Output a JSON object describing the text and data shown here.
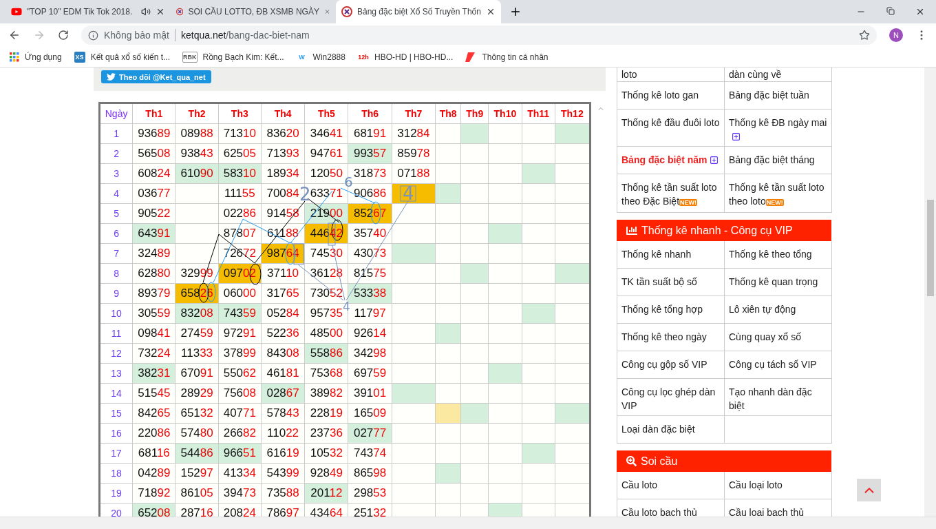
{
  "browser": {
    "tabs": [
      {
        "title": "\"TOP 10\" EDM Tik Tok 2018.",
        "kind": "video",
        "audio": true,
        "selected": false
      },
      {
        "title": "SOI CẦU LOTTO, ĐB XSMB NGÀY",
        "kind": "site",
        "audio": false,
        "selected": false
      },
      {
        "title": "Bảng đặc biệt Xổ Số Truyền Thốn",
        "kind": "site",
        "audio": false,
        "selected": true
      }
    ],
    "address": {
      "security": "Không bảo mật",
      "domain": "ketqua.net",
      "path": "/bang-dac-biet-nam"
    },
    "profile": "N",
    "bookmarks": [
      {
        "label": "Ứng dụng",
        "kind": "apps"
      },
      {
        "label": "Kết quả xổ số kiến t...",
        "kind": "tile",
        "icon_text": "XS"
      },
      {
        "label": "Rồng Bạch Kim: Kết...",
        "kind": "framed",
        "icon_text": "RBK"
      },
      {
        "label": "Win2888",
        "kind": "letter",
        "icon_text": "W"
      },
      {
        "label": "HBO-HD | HBO-HD...",
        "kind": "redtext",
        "icon_text": "12h"
      },
      {
        "label": "Thông tin cá nhân",
        "kind": "mark"
      }
    ]
  },
  "follow_button": "Theo dõi @Ket_qua_net",
  "table": {
    "day_header": "Ngày",
    "columns": [
      "Th1",
      "Th2",
      "Th3",
      "Th4",
      "Th5",
      "Th6",
      "Th7",
      "Th8",
      "Th9",
      "Th10",
      "Th11",
      "Th12"
    ],
    "rows": [
      {
        "day": "1",
        "cells": [
          {
            "value": "93689"
          },
          {
            "value": "08988"
          },
          {
            "value": "71310"
          },
          {
            "value": "83620"
          },
          {
            "value": "34641"
          },
          {
            "value": "68191"
          },
          {
            "value": "31284"
          },
          {},
          {
            "color": "#d4efdb"
          },
          {},
          {},
          {
            "color": "#d4efdb"
          }
        ]
      },
      {
        "day": "2",
        "cells": [
          {
            "value": "56508"
          },
          {
            "value": "93843"
          },
          {
            "value": "62505"
          },
          {
            "value": "71393"
          },
          {
            "value": "94761"
          },
          {
            "value": "99357",
            "color": "#d4efdb"
          },
          {
            "value": "85978"
          },
          {},
          {},
          {},
          {},
          {}
        ]
      },
      {
        "day": "3",
        "cells": [
          {
            "value": "60824"
          },
          {
            "value": "61090",
            "color": "#d4efdb"
          },
          {
            "value": "58310",
            "color": "#d4efdb"
          },
          {
            "value": "18934"
          },
          {
            "value": "12050"
          },
          {
            "value": "31873"
          },
          {
            "value": "07188"
          },
          {},
          {},
          {},
          {
            "color": "#d4efdb"
          },
          {}
        ]
      },
      {
        "day": "4",
        "cells": [
          {
            "value": "03677"
          },
          {},
          {
            "value": "11155"
          },
          {
            "value": "70084"
          },
          {
            "value": "63371"
          },
          {
            "value": "90686"
          },
          {
            "color": "#f5bc00"
          },
          {
            "color": "#d4efdb"
          },
          {},
          {},
          {},
          {}
        ]
      },
      {
        "day": "5",
        "cells": [
          {
            "value": "90522"
          },
          {},
          {
            "value": "02286"
          },
          {
            "value": "91458"
          },
          {
            "value": "21900",
            "color": "#d4efdb"
          },
          {
            "value": "85267",
            "color": "#f5bc00"
          },
          {},
          {},
          {},
          {},
          {},
          {}
        ]
      },
      {
        "day": "6",
        "cells": [
          {
            "value": "64391",
            "color": "#d4efdb"
          },
          {},
          {
            "value": "87807"
          },
          {
            "value": "61188"
          },
          {
            "value": "44642",
            "color": "#f5bc00"
          },
          {
            "value": "35740"
          },
          {},
          {},
          {},
          {
            "color": "#d4efdb"
          },
          {},
          {}
        ]
      },
      {
        "day": "7",
        "cells": [
          {
            "value": "32489"
          },
          {},
          {
            "value": "72672"
          },
          {
            "value": "98764",
            "color": "#f5bc00"
          },
          {
            "value": "74530"
          },
          {
            "value": "43073"
          },
          {
            "color": "#d4efdb"
          },
          {},
          {},
          {},
          {},
          {}
        ]
      },
      {
        "day": "8",
        "cells": [
          {
            "value": "62880"
          },
          {
            "value": "32999"
          },
          {
            "value": "09702",
            "color": "#f5bc00"
          },
          {
            "value": "37110"
          },
          {
            "value": "36128"
          },
          {
            "value": "81575"
          },
          {},
          {},
          {
            "color": "#d4efdb"
          },
          {},
          {},
          {
            "color": "#d4efdb"
          }
        ]
      },
      {
        "day": "9",
        "cells": [
          {
            "value": "89379"
          },
          {
            "value": "65826",
            "color": "#f5bc00"
          },
          {
            "value": "06000"
          },
          {
            "value": "31765"
          },
          {
            "value": "73052"
          },
          {
            "value": "53338",
            "color": "#d4efdb"
          },
          {},
          {},
          {},
          {},
          {},
          {}
        ]
      },
      {
        "day": "10",
        "cells": [
          {
            "value": "30559"
          },
          {
            "value": "83208",
            "color": "#d4efdb"
          },
          {
            "value": "74359",
            "color": "#d4efdb"
          },
          {
            "value": "05284"
          },
          {
            "value": "95735"
          },
          {
            "value": "11797"
          },
          {},
          {},
          {},
          {},
          {
            "color": "#d4efdb"
          },
          {}
        ]
      },
      {
        "day": "11",
        "cells": [
          {
            "value": "09841"
          },
          {
            "value": "27459"
          },
          {
            "value": "97291"
          },
          {
            "value": "52236"
          },
          {
            "value": "48500"
          },
          {
            "value": "92614"
          },
          {},
          {
            "color": "#d4efdb"
          },
          {},
          {},
          {},
          {}
        ]
      },
      {
        "day": "12",
        "cells": [
          {
            "value": "73224"
          },
          {
            "value": "11333"
          },
          {
            "value": "37899"
          },
          {
            "value": "84308"
          },
          {
            "value": "55886",
            "color": "#d4efdb"
          },
          {
            "value": "34298"
          },
          {},
          {},
          {},
          {},
          {},
          {}
        ]
      },
      {
        "day": "13",
        "cells": [
          {
            "value": "38231",
            "color": "#d4efdb"
          },
          {
            "value": "67091"
          },
          {
            "value": "55062"
          },
          {
            "value": "46181"
          },
          {
            "value": "75368"
          },
          {
            "value": "69759"
          },
          {},
          {},
          {},
          {
            "color": "#d4efdb"
          },
          {},
          {}
        ]
      },
      {
        "day": "14",
        "cells": [
          {
            "value": "51545"
          },
          {
            "value": "28929"
          },
          {
            "value": "75608"
          },
          {
            "value": "02867",
            "color": "#d4efdb"
          },
          {
            "value": "38982"
          },
          {
            "value": "39101"
          },
          {
            "color": "#d4efdb"
          },
          {},
          {},
          {},
          {},
          {}
        ]
      },
      {
        "day": "15",
        "cells": [
          {
            "value": "84265"
          },
          {
            "value": "65132"
          },
          {
            "value": "40771"
          },
          {
            "value": "57843"
          },
          {
            "value": "22819"
          },
          {
            "value": "16509"
          },
          {},
          {
            "color": "#fbe9a2"
          },
          {
            "color": "#d4efdb"
          },
          {},
          {},
          {
            "color": "#d4efdb"
          }
        ]
      },
      {
        "day": "16",
        "cells": [
          {
            "value": "22086"
          },
          {
            "value": "57480"
          },
          {
            "value": "26682"
          },
          {
            "value": "11022"
          },
          {
            "value": "23736"
          },
          {
            "value": "02777",
            "color": "#d4efdb"
          },
          {},
          {},
          {},
          {},
          {},
          {}
        ]
      },
      {
        "day": "17",
        "cells": [
          {
            "value": "68116"
          },
          {
            "value": "54486",
            "color": "#d4efdb"
          },
          {
            "value": "96651",
            "color": "#d4efdb"
          },
          {
            "value": "61619"
          },
          {
            "value": "10532"
          },
          {
            "value": "74374"
          },
          {},
          {},
          {},
          {},
          {
            "color": "#d4efdb"
          },
          {}
        ]
      },
      {
        "day": "18",
        "cells": [
          {
            "value": "04289"
          },
          {
            "value": "15297"
          },
          {
            "value": "41334"
          },
          {
            "value": "54399"
          },
          {
            "value": "92849"
          },
          {
            "value": "86598"
          },
          {},
          {
            "color": "#d4efdb"
          },
          {},
          {},
          {},
          {}
        ]
      },
      {
        "day": "19",
        "cells": [
          {
            "value": "71892"
          },
          {
            "value": "86105"
          },
          {
            "value": "39473"
          },
          {
            "value": "73588"
          },
          {
            "value": "20112",
            "color": "#d4efdb"
          },
          {
            "value": "29853"
          },
          {},
          {},
          {},
          {},
          {},
          {}
        ]
      },
      {
        "day": "20",
        "cells": [
          {
            "value": "65208",
            "color": "#d4efdb"
          },
          {
            "value": "28716"
          },
          {
            "value": "20824"
          },
          {
            "value": "78697"
          },
          {
            "value": "43464"
          },
          {
            "value": "25132"
          },
          {},
          {},
          {},
          {
            "color": "#d4efdb"
          },
          {},
          {}
        ]
      }
    ]
  },
  "annotations": [
    {
      "text": "2"
    },
    {
      "text": "6"
    },
    {
      "text": "4"
    },
    {
      "text": "4"
    }
  ],
  "sidebar": {
    "groups": [
      {
        "items": [
          {
            "label": "loto",
            "selected": false
          },
          {
            "label": "dàn cùng về",
            "selected": false
          },
          {
            "label": "Thống kê loto gan",
            "selected": false
          },
          {
            "label": "Bảng đặc biệt tuần",
            "selected": false
          },
          {
            "label": "Thống kê đầu đuôi loto",
            "selected": false
          },
          {
            "label": "Thống kê ĐB ngày mai",
            "selected": false,
            "expandable": true
          },
          {
            "label": "Bảng đặc biệt năm",
            "selected": true,
            "expandable": true
          },
          {
            "label": "Bảng đặc biệt tháng",
            "selected": false
          },
          {
            "label": "Thống kê tần suất loto theo Đặc Biệt",
            "selected": false,
            "badge": "NEW!"
          },
          {
            "label": "Thống kê tần suất loto theo loto",
            "selected": false,
            "badge": "NEW!"
          }
        ]
      },
      {
        "title": "Thống kê nhanh - Công cụ VIP",
        "kind": "chart",
        "items": [
          {
            "label": "Thống kê nhanh",
            "selected": false
          },
          {
            "label": "Thống kê theo tổng",
            "selected": false
          },
          {
            "label": "TK tần suất bộ số",
            "selected": false
          },
          {
            "label": "Thống kê quan trọng",
            "selected": false
          },
          {
            "label": "Thống kê tổng hợp",
            "selected": false
          },
          {
            "label": "Lô xiên tự động",
            "selected": false
          },
          {
            "label": "Thống kê theo ngày",
            "selected": false
          },
          {
            "label": "Cùng quay xổ số",
            "selected": false
          },
          {
            "label": "Công cụ gộp số VIP",
            "selected": false
          },
          {
            "label": "Công cụ tách số VIP",
            "selected": false
          },
          {
            "label": "Công cụ lọc ghép dàn VIP",
            "selected": false
          },
          {
            "label": "Tạo nhanh dàn đặc biệt",
            "selected": false
          },
          {
            "label": "Loại dàn đặc biệt",
            "selected": false
          }
        ]
      },
      {
        "title": "Soi cầu",
        "kind": "search",
        "items": [
          {
            "label": "Cầu loto",
            "selected": false
          },
          {
            "label": "Cầu loại loto",
            "selected": false
          },
          {
            "label": "Cầu loto bạch thủ",
            "selected": false
          },
          {
            "label": "Cầu loại bạch thủ",
            "selected": false
          }
        ]
      }
    ]
  }
}
